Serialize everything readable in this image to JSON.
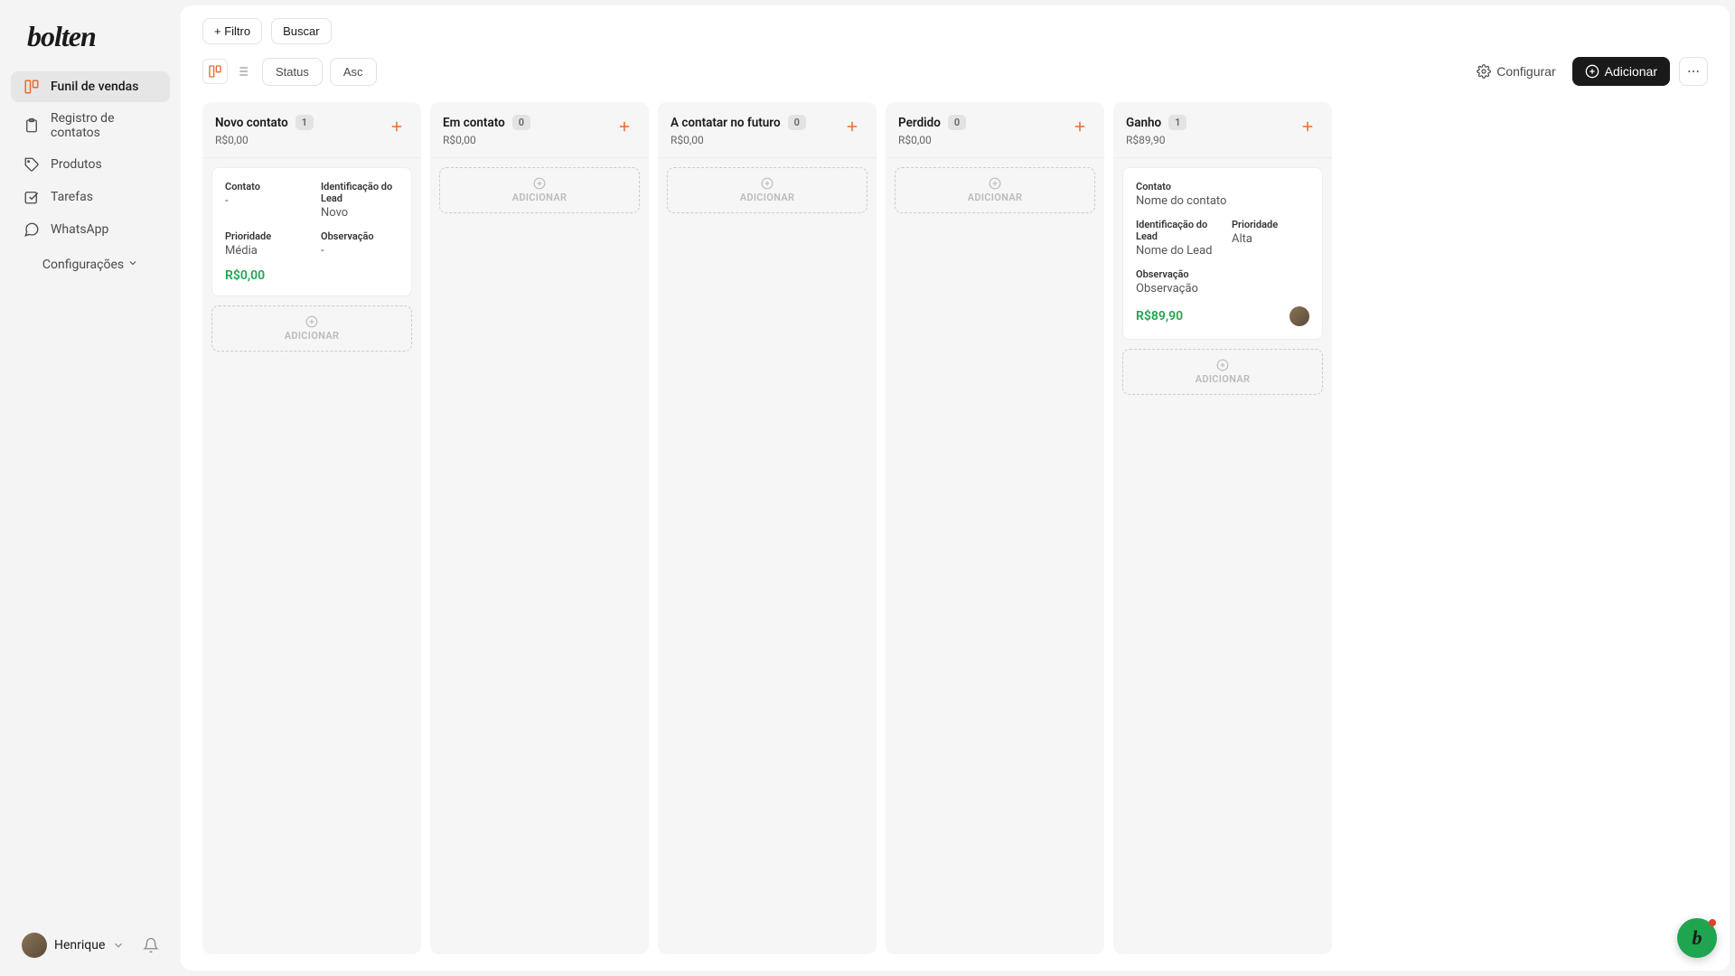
{
  "brand": "bolten",
  "sidebar": {
    "items": [
      {
        "label": "Funil de vendas",
        "icon": "kanban-icon",
        "active": true
      },
      {
        "label": "Registro de contatos",
        "icon": "clipboard-icon",
        "active": false
      },
      {
        "label": "Produtos",
        "icon": "tag-icon",
        "active": false
      },
      {
        "label": "Tarefas",
        "icon": "check-square-icon",
        "active": false
      },
      {
        "label": "WhatsApp",
        "icon": "chat-icon",
        "active": false
      }
    ],
    "config_label": "Configurações",
    "user": "Henrique"
  },
  "toolbar": {
    "filter_btn": "+ Filtro",
    "search_btn": "Buscar",
    "sort_by": "Status",
    "sort_dir": "Asc",
    "configure": "Configurar",
    "add": "Adicionar"
  },
  "board": {
    "add_card_label": "ADICIONAR",
    "columns": [
      {
        "title": "Novo contato",
        "count": "1",
        "amount": "R$0,00",
        "cards": [
          {
            "fields": [
              {
                "label": "Contato",
                "value": "-"
              },
              {
                "label": "Identificação do Lead",
                "value": "Novo"
              },
              {
                "label": "Prioridade",
                "value": "Média"
              },
              {
                "label": "Observação",
                "value": "-"
              }
            ],
            "price": "R$0,00",
            "avatar": false
          }
        ]
      },
      {
        "title": "Em contato",
        "count": "0",
        "amount": "R$0,00",
        "cards": []
      },
      {
        "title": "A contatar no futuro",
        "count": "0",
        "amount": "R$0,00",
        "cards": []
      },
      {
        "title": "Perdido",
        "count": "0",
        "amount": "R$0,00",
        "cards": []
      },
      {
        "title": "Ganho",
        "count": "1",
        "amount": "R$89,90",
        "cards": [
          {
            "fields": [
              {
                "label": "Contato",
                "value": "Nome do contato",
                "full": true
              },
              {
                "label": "Identificação do Lead",
                "value": "Nome do Lead"
              },
              {
                "label": "Prioridade",
                "value": "Alta"
              },
              {
                "label": "Observação",
                "value": "Observação",
                "full": true
              }
            ],
            "price": "R$89,90",
            "avatar": true
          }
        ]
      }
    ]
  },
  "fab": "b"
}
